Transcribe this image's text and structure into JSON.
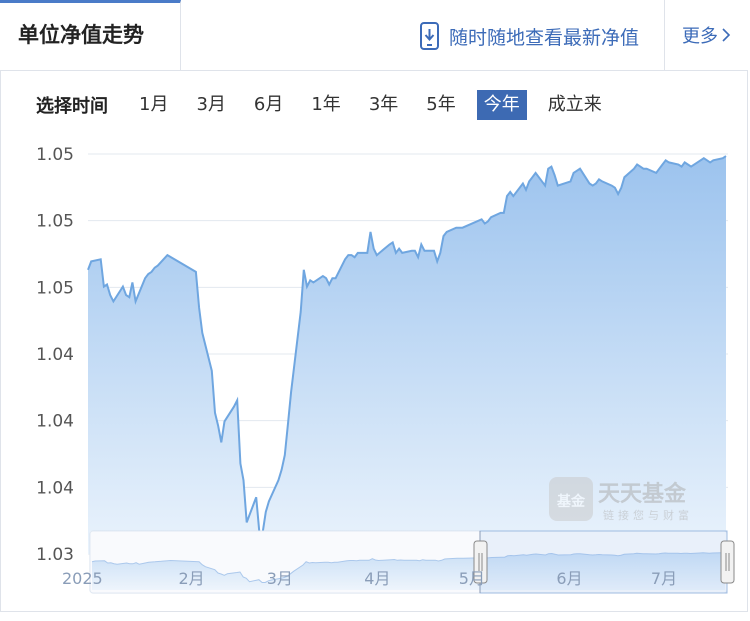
{
  "header": {
    "title": "单位净值走势",
    "app_link": "随时随地查看最新净值",
    "more": "更多"
  },
  "filters": {
    "label": "选择时间",
    "ranges": [
      "1月",
      "3月",
      "6月",
      "1年",
      "3年",
      "5年",
      "今年",
      "成立来"
    ],
    "active": "今年"
  },
  "watermark": {
    "logo": "基金",
    "name": "天天基金",
    "slogan": "链接您与财富"
  },
  "colors": {
    "accent": "#3d6ab3",
    "line": "#6fa6e0",
    "area_top": "#9cc3ee",
    "area_bottom": "#eaf3fc"
  },
  "chart_data": {
    "type": "area",
    "y_ticks": [
      "1.05",
      "1.05",
      "1.05",
      "1.04",
      "1.04",
      "1.04",
      "1.03"
    ],
    "ylim": [
      1.0335,
      1.0525
    ],
    "x_labels": [],
    "navigator_x_labels": [
      "2025",
      "2月",
      "3月",
      "4月",
      "5月",
      "6月",
      "7月"
    ],
    "grid": "horizontal",
    "series": [
      {
        "x": [
          "2025-01-02",
          "2025-01-03",
          "2025-01-06",
          "2025-01-07",
          "2025-01-08",
          "2025-01-09",
          "2025-01-10",
          "2025-01-13",
          "2025-01-14",
          "2025-01-15",
          "2025-01-16",
          "2025-01-17",
          "2025-01-20",
          "2025-01-21",
          "2025-01-22",
          "2025-01-23",
          "2025-01-24",
          "2025-01-27",
          "2025-02-05",
          "2025-02-06",
          "2025-02-07",
          "2025-02-10",
          "2025-02-11",
          "2025-02-12",
          "2025-02-13",
          "2025-02-14",
          "2025-02-17",
          "2025-02-18",
          "2025-02-19",
          "2025-02-20",
          "2025-02-21",
          "2025-02-24",
          "2025-02-25",
          "2025-02-26",
          "2025-02-27",
          "2025-02-28",
          "2025-03-03",
          "2025-03-04",
          "2025-03-05",
          "2025-03-06",
          "2025-03-07",
          "2025-03-10",
          "2025-03-11",
          "2025-03-12",
          "2025-03-13",
          "2025-03-14",
          "2025-03-17",
          "2025-03-18",
          "2025-03-19",
          "2025-03-20",
          "2025-03-21",
          "2025-03-24",
          "2025-03-25",
          "2025-03-26",
          "2025-03-27",
          "2025-03-28",
          "2025-03-31",
          "2025-04-01",
          "2025-04-02",
          "2025-04-03",
          "2025-04-07",
          "2025-04-08",
          "2025-04-09",
          "2025-04-10",
          "2025-04-11",
          "2025-04-14",
          "2025-04-15",
          "2025-04-16",
          "2025-04-17",
          "2025-04-18",
          "2025-04-21",
          "2025-04-22",
          "2025-04-23",
          "2025-04-24",
          "2025-04-25",
          "2025-04-28",
          "2025-04-29",
          "2025-04-30",
          "2025-05-06",
          "2025-05-07",
          "2025-05-08",
          "2025-05-09",
          "2025-05-12",
          "2025-05-13",
          "2025-05-14",
          "2025-05-15",
          "2025-05-16",
          "2025-05-19",
          "2025-05-20",
          "2025-05-21",
          "2025-05-22",
          "2025-05-23",
          "2025-05-26",
          "2025-05-27",
          "2025-05-28",
          "2025-05-29",
          "2025-05-30",
          "2025-06-03",
          "2025-06-04",
          "2025-06-05",
          "2025-06-06",
          "2025-06-09",
          "2025-06-10",
          "2025-06-11",
          "2025-06-12",
          "2025-06-13",
          "2025-06-16",
          "2025-06-17",
          "2025-06-18",
          "2025-06-19",
          "2025-06-20",
          "2025-06-23",
          "2025-06-24",
          "2025-06-25",
          "2025-06-26",
          "2025-06-27",
          "2025-06-30",
          "2025-07-01",
          "2025-07-02",
          "2025-07-03",
          "2025-07-04",
          "2025-07-07",
          "2025-07-08",
          "2025-07-09",
          "2025-07-10",
          "2025-07-11",
          "2025-07-14",
          "2025-07-15",
          "2025-07-16",
          "2025-07-17",
          "2025-07-18",
          "2025-07-21",
          "2025-07-22"
        ],
        "values": [
          1.047,
          1.0474,
          1.0475,
          1.0462,
          1.0463,
          1.0458,
          1.0455,
          1.0462,
          1.0458,
          1.0457,
          1.0464,
          1.0455,
          1.0466,
          1.0468,
          1.0469,
          1.0471,
          1.0472,
          1.0477,
          1.0469,
          1.0452,
          1.044,
          1.0422,
          1.0402,
          1.0396,
          1.0388,
          1.0398,
          1.0405,
          1.0408,
          1.0378,
          1.037,
          1.035,
          1.0362,
          1.0345,
          1.0345,
          1.0355,
          1.036,
          1.037,
          1.0375,
          1.0382,
          1.0397,
          1.0412,
          1.045,
          1.047,
          1.0462,
          1.0465,
          1.0464,
          1.0467,
          1.0466,
          1.0463,
          1.0466,
          1.0466,
          1.0475,
          1.0477,
          1.0477,
          1.0476,
          1.0478,
          1.0478,
          1.0488,
          1.048,
          1.0477,
          1.0482,
          1.0483,
          1.0478,
          1.048,
          1.0478,
          1.0479,
          1.0479,
          1.0476,
          1.0482,
          1.0479,
          1.0479,
          1.0474,
          1.0478,
          1.0486,
          1.0488,
          1.049,
          1.049,
          1.049,
          1.0494,
          1.0492,
          1.0493,
          1.0495,
          1.0497,
          1.0497,
          1.0505,
          1.0507,
          1.0505,
          1.0511,
          1.0508,
          1.0512,
          1.0514,
          1.0516,
          1.051,
          1.0518,
          1.0519,
          1.0515,
          1.051,
          1.0512,
          1.0516,
          1.0517,
          1.0518,
          1.0511,
          1.051,
          1.0511,
          1.0513,
          1.0512,
          1.051,
          1.0509,
          1.0506,
          1.0509,
          1.0514,
          1.0518,
          1.052,
          1.0519,
          1.0518,
          1.0518,
          1.0516,
          1.0518,
          1.052,
          1.0522,
          1.0521,
          1.052,
          1.0519,
          1.0521,
          1.052,
          1.0519,
          1.0522,
          1.0523,
          1.0522,
          1.0521,
          1.0522,
          1.0523,
          1.0524
        ]
      }
    ]
  }
}
